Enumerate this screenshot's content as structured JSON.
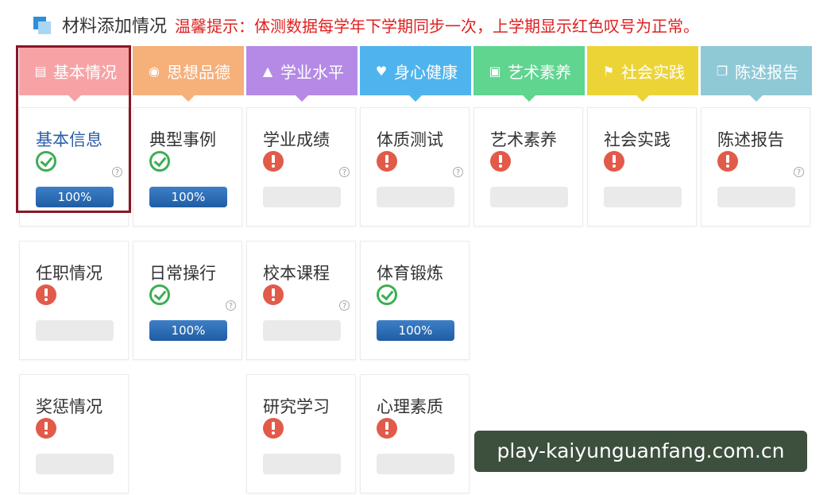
{
  "header": {
    "title": "材料添加情况",
    "tip": "温馨提示：体测数据每学年下学期同步一次，上学期显示红色叹号为正常。"
  },
  "colors": {
    "tip": "#e02020",
    "active_border": "#8a1626",
    "progress_bar": "#2a6db5",
    "status_ok": "#3cae54",
    "status_err": "#e25a49"
  },
  "tabs": [
    {
      "label": "基本情况",
      "icon": "document-icon",
      "color": "#f7a3a5"
    },
    {
      "label": "思想品德",
      "icon": "lifebuoy-icon",
      "color": "#f6b07a"
    },
    {
      "label": "学业水平",
      "icon": "graduation-cap-icon",
      "color": "#b58ae6"
    },
    {
      "label": "身心健康",
      "icon": "heartbeat-icon",
      "color": "#4fb4ee"
    },
    {
      "label": "艺术素养",
      "icon": "picture-icon",
      "color": "#5fd58f"
    },
    {
      "label": "社会实践",
      "icon": "flag-icon",
      "color": "#ecd437"
    },
    {
      "label": "陈述报告",
      "icon": "copy-icon",
      "color": "#8fc9d6"
    }
  ],
  "cards": [
    {
      "name": "基本信息",
      "status": "ok",
      "progress": 1.0,
      "progress_label": "100%",
      "help": true,
      "active": true
    },
    {
      "name": "典型事例",
      "status": "ok",
      "progress": 1.0,
      "progress_label": "100%",
      "help": false
    },
    {
      "name": "学业成绩",
      "status": "err",
      "progress": 0,
      "progress_label": "",
      "help": true
    },
    {
      "name": "体质测试",
      "status": "err",
      "progress": 0,
      "progress_label": "",
      "help": true
    },
    {
      "name": "艺术素养",
      "status": "err",
      "progress": 0,
      "progress_label": "",
      "help": false
    },
    {
      "name": "社会实践",
      "status": "err",
      "progress": 0,
      "progress_label": "",
      "help": false
    },
    {
      "name": "陈述报告",
      "status": "err",
      "progress": 0,
      "progress_label": "",
      "help": true
    },
    {
      "name": "任职情况",
      "status": "err",
      "progress": 0,
      "progress_label": "",
      "help": false
    },
    {
      "name": "日常操行",
      "status": "ok",
      "progress": 1.0,
      "progress_label": "100%",
      "help": true
    },
    {
      "name": "校本课程",
      "status": "err",
      "progress": 0,
      "progress_label": "",
      "help": true
    },
    {
      "name": "体育锻炼",
      "status": "ok",
      "progress": 1.0,
      "progress_label": "100%",
      "help": false
    },
    {
      "name": "奖惩情况",
      "status": "err",
      "progress": 0,
      "progress_label": "",
      "help": false
    },
    {
      "name": "研究学习",
      "status": "err",
      "progress": 0,
      "progress_label": "",
      "help": false
    },
    {
      "name": "心理素质",
      "status": "err",
      "progress": 0,
      "progress_label": "",
      "help": false
    }
  ],
  "help_glyph": "?",
  "watermark": "play-kaiyunguanfang.com.cn"
}
